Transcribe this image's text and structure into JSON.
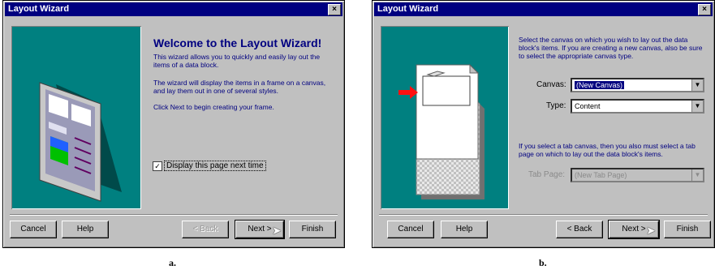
{
  "window_a": {
    "title": "Layout Wizard",
    "close": "×",
    "heading": "Welcome to the Layout Wizard!",
    "para1": "This wizard allows you to quickly and easily lay out the items of a data block.",
    "para2": "The wizard will display the items in a frame on a canvas, and lay them out in one of several styles.",
    "para3": "Click Next to begin creating your frame.",
    "checkbox_label": "Display this page next time",
    "checkbox_mark": "✓",
    "buttons": {
      "cancel": "Cancel",
      "help": "Help",
      "back": "< Back",
      "next": "Next >",
      "finish": "Finish"
    }
  },
  "window_b": {
    "title": "Layout Wizard",
    "close": "×",
    "intro": "Select the canvas on which you wish to lay out the data block's items. If you are creating a new canvas, also be sure to select the appropriate canvas type.",
    "canvas_label": "Canvas:",
    "canvas_value": "(New Canvas)",
    "type_label": "Type:",
    "type_value": "Content",
    "tab_note": "If you select a tab canvas, then you also must select a tab page on which to lay out the data block's items.",
    "tab_page_label": "Tab Page:",
    "tab_page_value": "(New Tab Page)",
    "dropdown_arrow": "▼",
    "buttons": {
      "cancel": "Cancel",
      "help": "Help",
      "back": "< Back",
      "next": "Next >",
      "finish": "Finish"
    }
  },
  "captions": {
    "a": "a.",
    "b": "b."
  },
  "colors": {
    "title_bar": "#000080",
    "panel": "#008080",
    "face": "#c0c0c0",
    "text": "#000080"
  }
}
